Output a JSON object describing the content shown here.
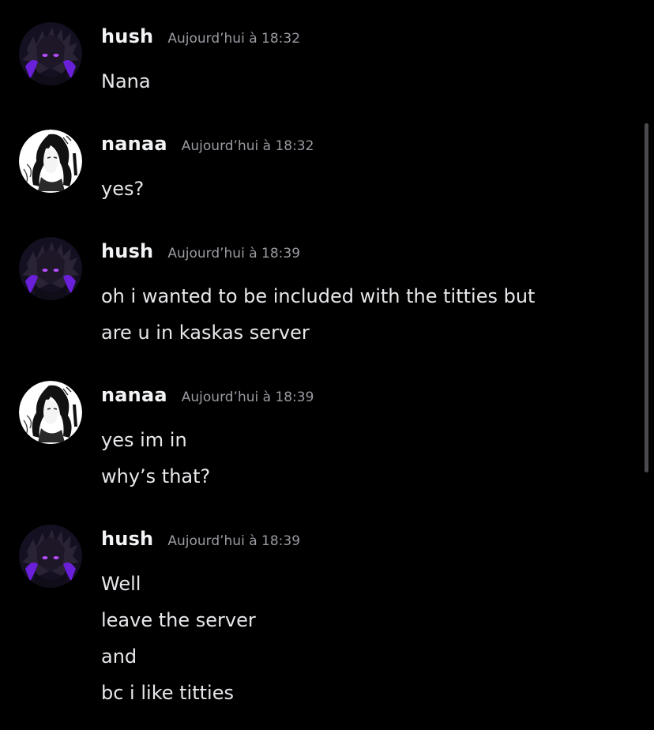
{
  "messages": [
    {
      "author": "hush",
      "avatar": "hush-avatar",
      "timestamp": "Aujourd’hui à 18:32",
      "lines": [
        "Nana"
      ]
    },
    {
      "author": "nanaa",
      "avatar": "nanaa-avatar",
      "timestamp": "Aujourd’hui à 18:32",
      "lines": [
        "yes?"
      ]
    },
    {
      "author": "hush",
      "avatar": "hush-avatar",
      "timestamp": "Aujourd’hui à 18:39",
      "lines": [
        "oh i wanted to be included with the titties but",
        "are u in kaskas server"
      ]
    },
    {
      "author": "nanaa",
      "avatar": "nanaa-avatar",
      "timestamp": "Aujourd’hui à 18:39",
      "lines": [
        "yes im in",
        "why’s that?"
      ]
    },
    {
      "author": "hush",
      "avatar": "hush-avatar",
      "timestamp": "Aujourd’hui à 18:39",
      "lines": [
        "Well",
        "leave the server",
        "and",
        "bc i like titties"
      ]
    }
  ],
  "colors": {
    "background": "#000000",
    "username": "#f2f3f5",
    "timestamp": "#9a9ba2",
    "message_text": "#e8e8ec",
    "hush_avatar_accent": "#7b2cff",
    "nanaa_avatar_bg": "#ffffff"
  }
}
